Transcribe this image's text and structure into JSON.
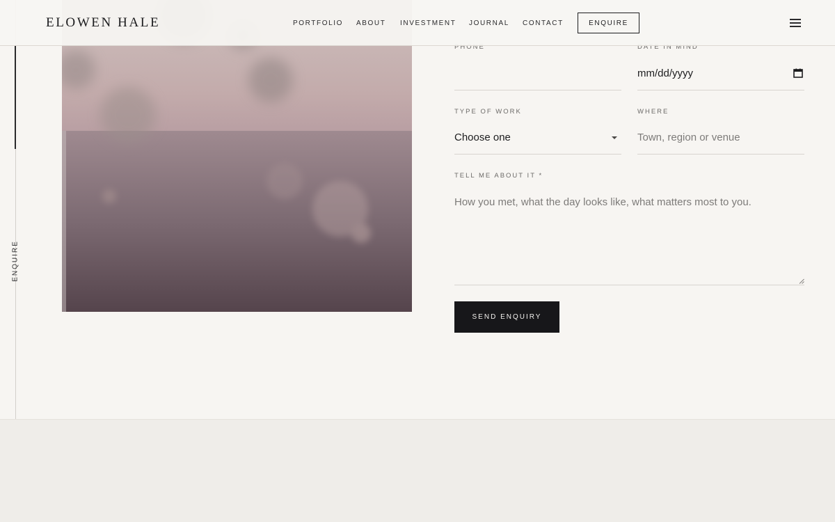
{
  "brand": {
    "name": "ELOWEN HALE"
  },
  "nav": {
    "items": [
      "PORTFOLIO",
      "ABOUT",
      "INVESTMENT",
      "JOURNAL",
      "CONTACT"
    ],
    "enquire_button": "ENQUIRE",
    "menu_icon": "hamburger-menu-icon"
  },
  "side_rail": {
    "label": "ENQUIRE"
  },
  "form": {
    "phone": {
      "label": "PHONE",
      "value": ""
    },
    "date": {
      "label": "DATE IN MIND",
      "value": "mm/dd/yyyy",
      "icon": "calendar-icon"
    },
    "type_of_work": {
      "label": "TYPE OF WORK",
      "selected": "Choose one"
    },
    "where": {
      "label": "WHERE",
      "placeholder": "Town, region or venue"
    },
    "message": {
      "label": "TELL ME ABOUT IT *",
      "placeholder": "How you met, what the day looks like, what matters most to you."
    },
    "submit_label": "SEND ENQUIRY"
  },
  "colors": {
    "background": "#f7f5f2",
    "button_dark": "#17171a",
    "text": "#1c1c1e",
    "muted": "#6c6a68"
  }
}
